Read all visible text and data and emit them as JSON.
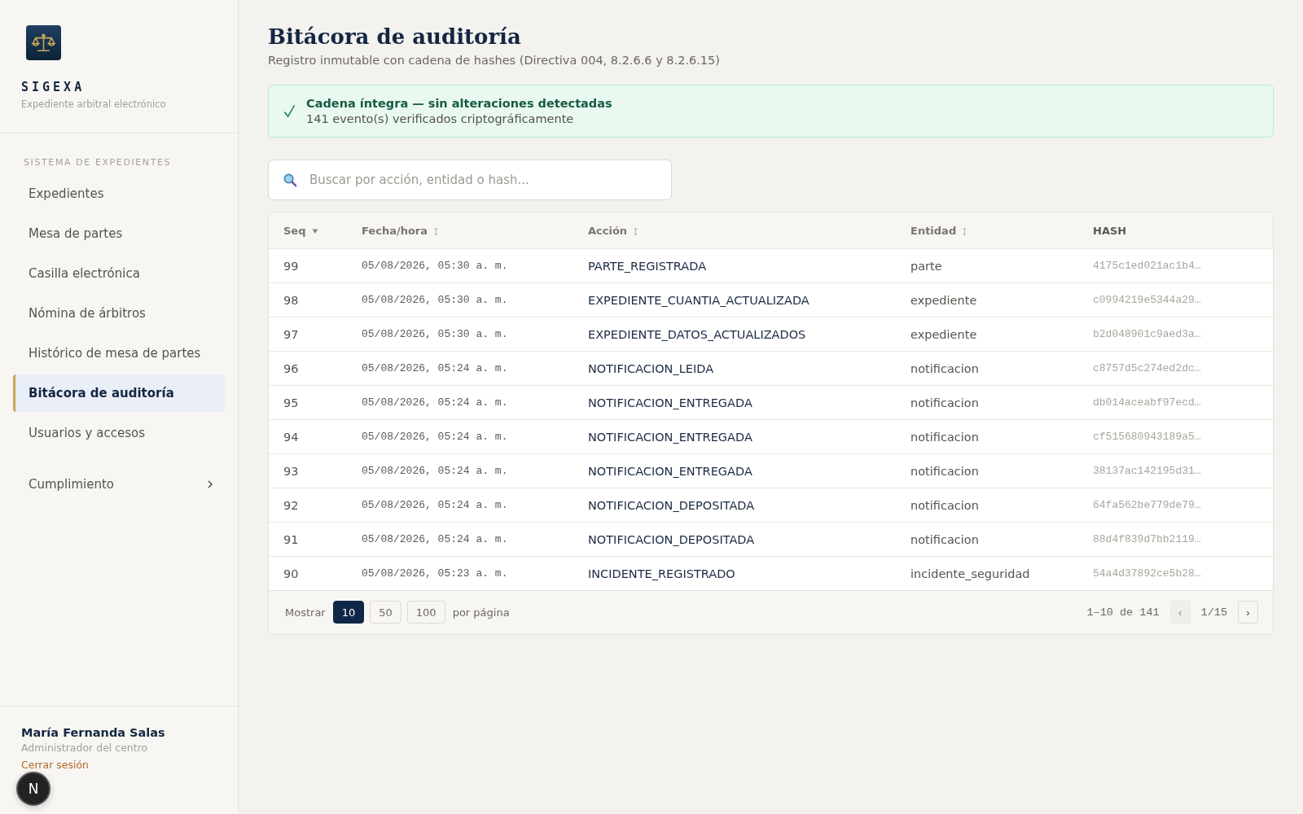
{
  "brand": {
    "name": "SIGEXA",
    "tagline": "Expediente arbitral electrónico"
  },
  "sidebar": {
    "section": "SISTEMA DE EXPEDIENTES",
    "items": [
      {
        "label": "Expedientes",
        "selected": false,
        "kind": "link"
      },
      {
        "label": "Mesa de partes",
        "selected": false,
        "kind": "link"
      },
      {
        "label": "Casilla electrónica",
        "selected": false,
        "kind": "link"
      },
      {
        "label": "Nómina de árbitros",
        "selected": false,
        "kind": "link"
      },
      {
        "label": "Histórico de mesa de partes",
        "selected": false,
        "kind": "link"
      },
      {
        "label": "Bitácora de auditoría",
        "selected": true,
        "kind": "link"
      },
      {
        "label": "Usuarios y accesos",
        "selected": false,
        "kind": "link"
      },
      {
        "label": "Cumplimiento",
        "selected": false,
        "kind": "group",
        "expanded": false
      }
    ]
  },
  "user": {
    "name": "María Fernanda Salas",
    "role": "Administrador del centro",
    "logout": "Cerrar sesión"
  },
  "dev_badge": {
    "letter": "N"
  },
  "page": {
    "title": "Bitácora de auditoría",
    "subtitle": "Registro inmutable con cadena de hashes (Directiva 004, 8.2.6.6 y 8.2.6.15)"
  },
  "integrity": {
    "ok": true,
    "title": "Cadena íntegra — sin alteraciones detectadas",
    "detail": "141 evento(s) verificados criptográficamente"
  },
  "search": {
    "placeholder": "Buscar por acción, entidad o hash..."
  },
  "table": {
    "columns": [
      {
        "label": "Seq",
        "sortable": true,
        "sorted_desc": true
      },
      {
        "label": "Fecha/hora",
        "sortable": true,
        "sorted_desc": false
      },
      {
        "label": "Acción",
        "sortable": true,
        "sorted_desc": false
      },
      {
        "label": "Entidad",
        "sortable": true,
        "sorted_desc": false
      },
      {
        "label": "HASH",
        "sortable": false
      }
    ],
    "rows": [
      [
        "99",
        "05/08/2026, 05:30 a. m.",
        "PARTE_REGISTRADA",
        "parte",
        "4175c1ed021ac1b4…"
      ],
      [
        "98",
        "05/08/2026, 05:30 a. m.",
        "EXPEDIENTE_CUANTIA_ACTUALIZADA",
        "expediente",
        "c0994219e5344a29…"
      ],
      [
        "97",
        "05/08/2026, 05:30 a. m.",
        "EXPEDIENTE_DATOS_ACTUALIZADOS",
        "expediente",
        "b2d048901c9aed3a…"
      ],
      [
        "96",
        "05/08/2026, 05:24 a. m.",
        "NOTIFICACION_LEIDA",
        "notificacion",
        "c8757d5c274ed2dc…"
      ],
      [
        "95",
        "05/08/2026, 05:24 a. m.",
        "NOTIFICACION_ENTREGADA",
        "notificacion",
        "db014aceabf97ecd…"
      ],
      [
        "94",
        "05/08/2026, 05:24 a. m.",
        "NOTIFICACION_ENTREGADA",
        "notificacion",
        "cf515680943189a5…"
      ],
      [
        "93",
        "05/08/2026, 05:24 a. m.",
        "NOTIFICACION_ENTREGADA",
        "notificacion",
        "38137ac142195d31…"
      ],
      [
        "92",
        "05/08/2026, 05:24 a. m.",
        "NOTIFICACION_DEPOSITADA",
        "notificacion",
        "64fa562be779de79…"
      ],
      [
        "91",
        "05/08/2026, 05:24 a. m.",
        "NOTIFICACION_DEPOSITADA",
        "notificacion",
        "88d4f839d7bb2119…"
      ],
      [
        "90",
        "05/08/2026, 05:23 a. m.",
        "INCIDENTE_REGISTRADO",
        "incidente_seguridad",
        "54a4d37892ce5b28…"
      ]
    ]
  },
  "pagination": {
    "show_label": "Mostrar",
    "sizes": [
      {
        "label": "10",
        "selected": true
      },
      {
        "label": "50",
        "selected": false
      },
      {
        "label": "100",
        "selected": false
      }
    ],
    "per_page_label": "por página",
    "range": "1–10 de 141",
    "prev": {
      "label": "‹",
      "disabled": true
    },
    "page": "1/15",
    "next": {
      "label": "›",
      "disabled": false
    }
  }
}
